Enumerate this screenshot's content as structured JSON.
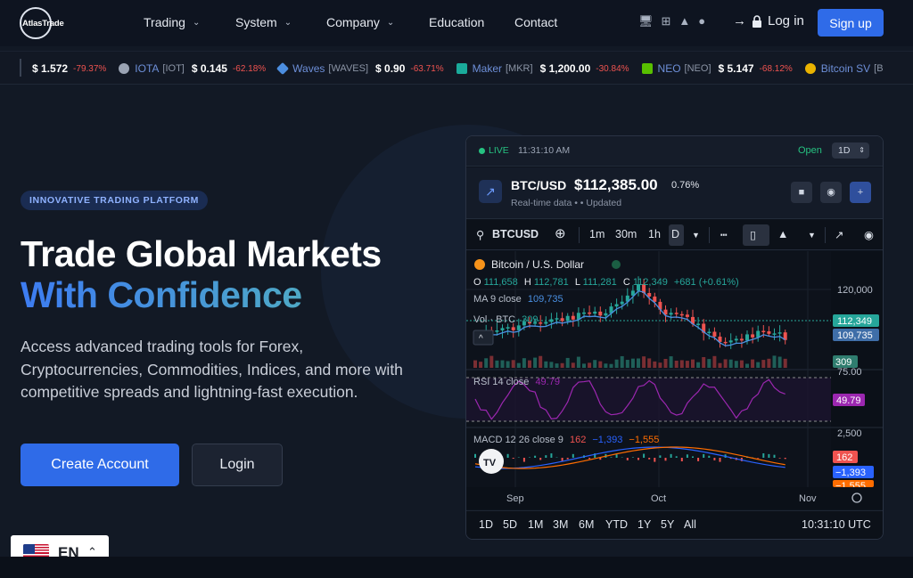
{
  "brand": {
    "logo_text": "AtlasTrade"
  },
  "nav": {
    "items": [
      {
        "label": "Trading",
        "dropdown": true
      },
      {
        "label": "System",
        "dropdown": true
      },
      {
        "label": "Company",
        "dropdown": true
      },
      {
        "label": "Education",
        "dropdown": false
      },
      {
        "label": "Contact",
        "dropdown": false
      }
    ],
    "platform_icons": [
      "desktop-icon",
      "windows-icon",
      "android-icon",
      "apple-icon"
    ],
    "login_label": "Log in",
    "signup_label": "Sign up"
  },
  "ticker": [
    {
      "name": "",
      "symbol": "",
      "price": "$ 1.572",
      "change": "-79.37%",
      "icon": "none"
    },
    {
      "name": "IOTA",
      "symbol": "[IOT]",
      "price": "$ 0.145",
      "change": "-62.18%",
      "icon": "iota-icon"
    },
    {
      "name": "Waves",
      "symbol": "[WAVES]",
      "price": "$ 0.90",
      "change": "-63.71%",
      "icon": "waves-icon"
    },
    {
      "name": "Maker",
      "symbol": "[MKR]",
      "price": "$ 1,200.00",
      "change": "-30.84%",
      "icon": "maker-icon"
    },
    {
      "name": "NEO",
      "symbol": "[NEO]",
      "price": "$ 5.147",
      "change": "-68.12%",
      "icon": "neo-icon"
    },
    {
      "name": "Bitcoin SV",
      "symbol": "[B",
      "price": "",
      "change": "",
      "icon": "bitcoin-sv-icon"
    }
  ],
  "hero": {
    "badge": "INNOVATIVE TRADING PLATFORM",
    "title_line1": "Trade Global Markets",
    "title_line2": "With Confidence",
    "description": "Access advanced trading tools for Forex, Cryptocurrencies, Commodities, Indices, and more with competitive spreads and lightning-fast execution.",
    "cta_primary": "Create Account",
    "cta_secondary": "Login"
  },
  "widget": {
    "live_label": "LIVE",
    "time": "11:31:10 AM",
    "status": "Open",
    "timeframe": "1D",
    "pair": "BTC/USD",
    "price": "$112,385.00",
    "change_pct": "0.76%",
    "subtitle": "Real-time data •  • Updated",
    "toolbar": {
      "symbol": "BTCUSD",
      "intervals": [
        "1m",
        "30m",
        "1h",
        "D"
      ],
      "active_interval": "D"
    },
    "legend": {
      "title": "Bitcoin / U.S. Dollar",
      "o_label": "O",
      "o": "111,658",
      "h_label": "H",
      "h": "112,781",
      "l_label": "L",
      "l": "111,281",
      "c_label": "C",
      "c": "112,349",
      "change": "+681 (+0.61%)",
      "ma_label": "MA 9 close",
      "ma_value": "109,735",
      "vol_label": "Vol · BTC",
      "vol_value": "309"
    },
    "price_axis": {
      "tick": "120,000",
      "last_price": "112,349",
      "ma_tag": "109,735",
      "vol_tag": "309"
    },
    "rsi": {
      "label": "RSI 14 close",
      "value": "49.79",
      "top": "75.00",
      "tag": "49.79"
    },
    "macd": {
      "label": "MACD 12 26 close 9",
      "hist": "162",
      "macd": "−1,393",
      "signal": "−1,555",
      "axis_tick": "2,500",
      "tag_hist": "162",
      "tag_macd": "−1,393",
      "tag_signal": "−1,555"
    },
    "time_axis": [
      "Sep",
      "Oct",
      "Nov"
    ],
    "ranges": [
      "1D",
      "5D",
      "1M",
      "3M",
      "6M",
      "YTD",
      "1Y",
      "5Y",
      "All"
    ],
    "clock": "10:31:10 UTC"
  },
  "chart_data": {
    "type": "line",
    "title": "Bitcoin / U.S. Dollar",
    "x": [
      "Sep",
      "Oct",
      "Nov"
    ],
    "series": [
      {
        "name": "MA 9 close",
        "values": [
          109735
        ]
      }
    ],
    "ohlc_last": {
      "open": 111658,
      "high": 112781,
      "low": 111281,
      "close": 112349
    },
    "ylabel": "",
    "xlabel": ""
  },
  "language": {
    "code": "EN"
  },
  "colors": {
    "accent": "#2f6be8",
    "up": "#26a69a",
    "down": "#ef5350",
    "live": "#26c281"
  }
}
